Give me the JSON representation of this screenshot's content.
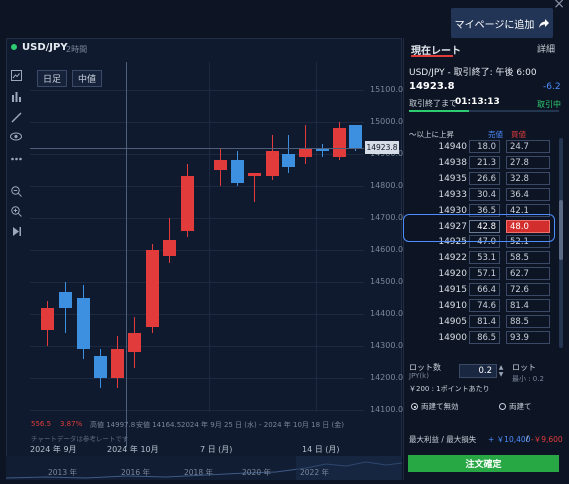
{
  "header": {
    "close_glyph": "×",
    "mypage_label": "マイページに追加",
    "mypage_icon": "share-arrow-icon"
  },
  "chart": {
    "symbol": "USD/JPY",
    "timeframe": "2時間",
    "buttons": [
      "日足",
      "中値"
    ],
    "y_labels": [
      "15100.0",
      "15000.0",
      "14900.0",
      "14800.0",
      "14700.0",
      "14600.0",
      "14500.0",
      "14400.0",
      "14300.0",
      "14200.0",
      "14100.0"
    ],
    "cursor_price": "14923.8",
    "info": {
      "v1": "556.5",
      "v2": "3.87%",
      "high": "高値 14997.8",
      "low": "安値 14164.5",
      "range": "2024 年 9月 25 日 (水) - 2024 年 10月 18 日 (金)",
      "note": "チャートデータは参考レートです"
    },
    "x_labels": [
      "2024 年 9月",
      "2024 年 10月",
      "7 日 (月)",
      "14 日 (月)"
    ],
    "mini_labels": [
      "2013 年",
      "2016 年",
      "2018 年",
      "2020 年",
      "2022 年"
    ],
    "colors": {
      "up": "#e23b3b",
      "down": "#3d8fe0"
    }
  },
  "panel": {
    "tab_active": "現在レート",
    "tab_other": "詳細",
    "pair_line": "USD/JPY - 取引終了: 午後 6:00",
    "price": "14923.8",
    "change": "-6.2",
    "close_label": "取引終了まで",
    "timer": "01:13:13",
    "status": "取引中",
    "table_header": {
      "strike": "〜以上に上昇",
      "buy": "売値",
      "sell": "買値"
    },
    "rows": [
      {
        "strike": "14940",
        "buy": "18.0",
        "sell": "24.7"
      },
      {
        "strike": "14938",
        "buy": "21.3",
        "sell": "27.8"
      },
      {
        "strike": "14935",
        "buy": "26.6",
        "sell": "32.8"
      },
      {
        "strike": "14933",
        "buy": "30.4",
        "sell": "36.4"
      },
      {
        "strike": "14930",
        "buy": "36.5",
        "sell": "42.1"
      },
      {
        "strike": "14927",
        "buy": "42.8",
        "sell": "48.0"
      },
      {
        "strike": "14925",
        "buy": "47.0",
        "sell": "52.1"
      },
      {
        "strike": "14922",
        "buy": "53.1",
        "sell": "58.5"
      },
      {
        "strike": "14920",
        "buy": "57.1",
        "sell": "62.7"
      },
      {
        "strike": "14915",
        "buy": "66.4",
        "sell": "72.6"
      },
      {
        "strike": "14910",
        "buy": "74.6",
        "sell": "81.4"
      },
      {
        "strike": "14905",
        "buy": "81.4",
        "sell": "88.5"
      },
      {
        "strike": "14900",
        "buy": "86.5",
        "sell": "93.9"
      }
    ],
    "lot": {
      "label": "ロット数",
      "unit": "JPY(k)",
      "value": "0.2",
      "right_label": "ロット",
      "min": "最小 : 0.2",
      "note": "￥200 : 1ポイントあたり"
    },
    "radio": {
      "opt1": "両建て無効",
      "opt2": "両建て"
    },
    "pl": {
      "label": "最大利益 / 最大損失",
      "profit": "+ ￥10,400",
      "sep": " / ",
      "loss": "-￥9,600"
    },
    "order_label": "注文確定"
  }
}
